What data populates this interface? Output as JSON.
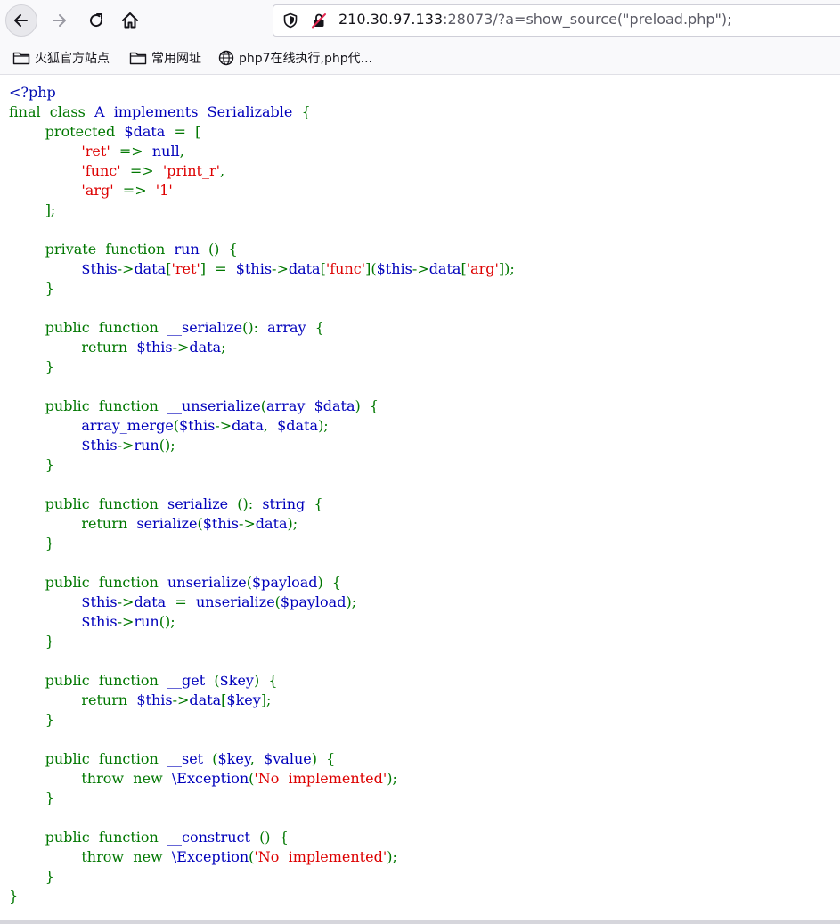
{
  "browser": {
    "url_host": "210.30.97.133",
    "url_rest": ":28073/?a=show_source(\"preload.php\");",
    "bookmarks": [
      {
        "label": "火狐官方站点",
        "icon": "folder-icon"
      },
      {
        "label": "常用网址",
        "icon": "folder-icon"
      },
      {
        "label": "php7在线执行,php代...",
        "icon": "globe-icon"
      }
    ]
  },
  "colors": {
    "html": "#000bb0",
    "keyword": "#007700",
    "default": "#0000bb",
    "string": "#dd0000"
  },
  "code_lines": [
    [
      {
        "c": "html",
        "t": "<?php"
      }
    ],
    [
      {
        "c": "keyword",
        "t": "final  class  "
      },
      {
        "c": "default",
        "t": "A  implements  Serializable  "
      },
      {
        "c": "keyword",
        "t": "{"
      }
    ],
    [
      {
        "c": "keyword",
        "t": "        protected  "
      },
      {
        "c": "default",
        "t": "$data  "
      },
      {
        "c": "keyword",
        "t": "=  ["
      }
    ],
    [
      {
        "c": "keyword",
        "t": "                "
      },
      {
        "c": "string",
        "t": "'ret'  "
      },
      {
        "c": "keyword",
        "t": "=>  "
      },
      {
        "c": "default",
        "t": "null"
      },
      {
        "c": "keyword",
        "t": ","
      }
    ],
    [
      {
        "c": "keyword",
        "t": "                "
      },
      {
        "c": "string",
        "t": "'func'  "
      },
      {
        "c": "keyword",
        "t": "=>  "
      },
      {
        "c": "string",
        "t": "'print_r'"
      },
      {
        "c": "keyword",
        "t": ","
      }
    ],
    [
      {
        "c": "keyword",
        "t": "                "
      },
      {
        "c": "string",
        "t": "'arg'  "
      },
      {
        "c": "keyword",
        "t": "=>  "
      },
      {
        "c": "string",
        "t": "'1'"
      }
    ],
    [
      {
        "c": "keyword",
        "t": "        ];"
      }
    ],
    [
      {
        "c": "keyword",
        "t": ""
      }
    ],
    [
      {
        "c": "keyword",
        "t": "        private  function  "
      },
      {
        "c": "default",
        "t": "run  "
      },
      {
        "c": "keyword",
        "t": "()  {"
      }
    ],
    [
      {
        "c": "keyword",
        "t": "                "
      },
      {
        "c": "default",
        "t": "$this"
      },
      {
        "c": "keyword",
        "t": "->"
      },
      {
        "c": "default",
        "t": "data"
      },
      {
        "c": "keyword",
        "t": "["
      },
      {
        "c": "string",
        "t": "'ret'"
      },
      {
        "c": "keyword",
        "t": "]  =  "
      },
      {
        "c": "default",
        "t": "$this"
      },
      {
        "c": "keyword",
        "t": "->"
      },
      {
        "c": "default",
        "t": "data"
      },
      {
        "c": "keyword",
        "t": "["
      },
      {
        "c": "string",
        "t": "'func'"
      },
      {
        "c": "keyword",
        "t": "]("
      },
      {
        "c": "default",
        "t": "$this"
      },
      {
        "c": "keyword",
        "t": "->"
      },
      {
        "c": "default",
        "t": "data"
      },
      {
        "c": "keyword",
        "t": "["
      },
      {
        "c": "string",
        "t": "'arg'"
      },
      {
        "c": "keyword",
        "t": "]);"
      }
    ],
    [
      {
        "c": "keyword",
        "t": "        }"
      }
    ],
    [
      {
        "c": "keyword",
        "t": ""
      }
    ],
    [
      {
        "c": "keyword",
        "t": "        public  function  "
      },
      {
        "c": "default",
        "t": "__serialize"
      },
      {
        "c": "keyword",
        "t": "():  "
      },
      {
        "c": "default",
        "t": "array  "
      },
      {
        "c": "keyword",
        "t": "{"
      }
    ],
    [
      {
        "c": "keyword",
        "t": "                return  "
      },
      {
        "c": "default",
        "t": "$this"
      },
      {
        "c": "keyword",
        "t": "->"
      },
      {
        "c": "default",
        "t": "data"
      },
      {
        "c": "keyword",
        "t": ";"
      }
    ],
    [
      {
        "c": "keyword",
        "t": "        }"
      }
    ],
    [
      {
        "c": "keyword",
        "t": ""
      }
    ],
    [
      {
        "c": "keyword",
        "t": "        public  function  "
      },
      {
        "c": "default",
        "t": "__unserialize"
      },
      {
        "c": "keyword",
        "t": "("
      },
      {
        "c": "default",
        "t": "array  $data"
      },
      {
        "c": "keyword",
        "t": ")  {"
      }
    ],
    [
      {
        "c": "keyword",
        "t": "                "
      },
      {
        "c": "default",
        "t": "array_merge"
      },
      {
        "c": "keyword",
        "t": "("
      },
      {
        "c": "default",
        "t": "$this"
      },
      {
        "c": "keyword",
        "t": "->"
      },
      {
        "c": "default",
        "t": "data"
      },
      {
        "c": "keyword",
        "t": ",  "
      },
      {
        "c": "default",
        "t": "$data"
      },
      {
        "c": "keyword",
        "t": ");"
      }
    ],
    [
      {
        "c": "keyword",
        "t": "                "
      },
      {
        "c": "default",
        "t": "$this"
      },
      {
        "c": "keyword",
        "t": "->"
      },
      {
        "c": "default",
        "t": "run"
      },
      {
        "c": "keyword",
        "t": "();"
      }
    ],
    [
      {
        "c": "keyword",
        "t": "        }"
      }
    ],
    [
      {
        "c": "keyword",
        "t": ""
      }
    ],
    [
      {
        "c": "keyword",
        "t": "        public  function  "
      },
      {
        "c": "default",
        "t": "serialize  "
      },
      {
        "c": "keyword",
        "t": "():  "
      },
      {
        "c": "default",
        "t": "string  "
      },
      {
        "c": "keyword",
        "t": "{"
      }
    ],
    [
      {
        "c": "keyword",
        "t": "                return  "
      },
      {
        "c": "default",
        "t": "serialize"
      },
      {
        "c": "keyword",
        "t": "("
      },
      {
        "c": "default",
        "t": "$this"
      },
      {
        "c": "keyword",
        "t": "->"
      },
      {
        "c": "default",
        "t": "data"
      },
      {
        "c": "keyword",
        "t": ");"
      }
    ],
    [
      {
        "c": "keyword",
        "t": "        }"
      }
    ],
    [
      {
        "c": "keyword",
        "t": ""
      }
    ],
    [
      {
        "c": "keyword",
        "t": "        public  function  "
      },
      {
        "c": "default",
        "t": "unserialize"
      },
      {
        "c": "keyword",
        "t": "("
      },
      {
        "c": "default",
        "t": "$payload"
      },
      {
        "c": "keyword",
        "t": ")  {"
      }
    ],
    [
      {
        "c": "keyword",
        "t": "                "
      },
      {
        "c": "default",
        "t": "$this"
      },
      {
        "c": "keyword",
        "t": "->"
      },
      {
        "c": "default",
        "t": "data  "
      },
      {
        "c": "keyword",
        "t": "=  "
      },
      {
        "c": "default",
        "t": "unserialize"
      },
      {
        "c": "keyword",
        "t": "("
      },
      {
        "c": "default",
        "t": "$payload"
      },
      {
        "c": "keyword",
        "t": ");"
      }
    ],
    [
      {
        "c": "keyword",
        "t": "                "
      },
      {
        "c": "default",
        "t": "$this"
      },
      {
        "c": "keyword",
        "t": "->"
      },
      {
        "c": "default",
        "t": "run"
      },
      {
        "c": "keyword",
        "t": "();"
      }
    ],
    [
      {
        "c": "keyword",
        "t": "        }"
      }
    ],
    [
      {
        "c": "keyword",
        "t": ""
      }
    ],
    [
      {
        "c": "keyword",
        "t": "        public  function  "
      },
      {
        "c": "default",
        "t": "__get  "
      },
      {
        "c": "keyword",
        "t": "("
      },
      {
        "c": "default",
        "t": "$key"
      },
      {
        "c": "keyword",
        "t": ")  {"
      }
    ],
    [
      {
        "c": "keyword",
        "t": "                return  "
      },
      {
        "c": "default",
        "t": "$this"
      },
      {
        "c": "keyword",
        "t": "->"
      },
      {
        "c": "default",
        "t": "data"
      },
      {
        "c": "keyword",
        "t": "["
      },
      {
        "c": "default",
        "t": "$key"
      },
      {
        "c": "keyword",
        "t": "];"
      }
    ],
    [
      {
        "c": "keyword",
        "t": "        }"
      }
    ],
    [
      {
        "c": "keyword",
        "t": ""
      }
    ],
    [
      {
        "c": "keyword",
        "t": "        public  function  "
      },
      {
        "c": "default",
        "t": "__set  "
      },
      {
        "c": "keyword",
        "t": "("
      },
      {
        "c": "default",
        "t": "$key"
      },
      {
        "c": "keyword",
        "t": ",  "
      },
      {
        "c": "default",
        "t": "$value"
      },
      {
        "c": "keyword",
        "t": ")  {"
      }
    ],
    [
      {
        "c": "keyword",
        "t": "                throw  new  "
      },
      {
        "c": "default",
        "t": "\\Exception"
      },
      {
        "c": "keyword",
        "t": "("
      },
      {
        "c": "string",
        "t": "'No  implemented'"
      },
      {
        "c": "keyword",
        "t": ");"
      }
    ],
    [
      {
        "c": "keyword",
        "t": "        }"
      }
    ],
    [
      {
        "c": "keyword",
        "t": ""
      }
    ],
    [
      {
        "c": "keyword",
        "t": "        public  function  "
      },
      {
        "c": "default",
        "t": "__construct  "
      },
      {
        "c": "keyword",
        "t": "()  {"
      }
    ],
    [
      {
        "c": "keyword",
        "t": "                throw  new  "
      },
      {
        "c": "default",
        "t": "\\Exception"
      },
      {
        "c": "keyword",
        "t": "("
      },
      {
        "c": "string",
        "t": "'No  implemented'"
      },
      {
        "c": "keyword",
        "t": ");"
      }
    ],
    [
      {
        "c": "keyword",
        "t": "        }"
      }
    ],
    [
      {
        "c": "keyword",
        "t": "}"
      }
    ]
  ]
}
